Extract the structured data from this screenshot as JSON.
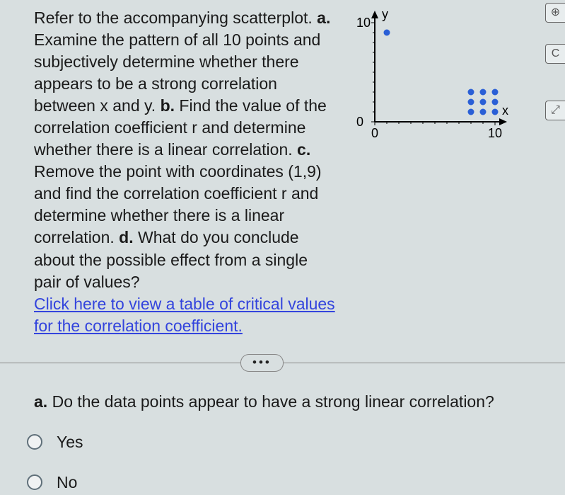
{
  "question": {
    "intro": "Refer to the accompanying scatterplot. ",
    "a_label": "a.",
    "a_text": " Examine the pattern of all 10 points and subjectively determine whether there appears to be a strong correlation between x and y. ",
    "b_label": "b.",
    "b_text": " Find the value of the correlation coefficient r and determine whether there is a linear correlation. ",
    "c_label": "c.",
    "c_text": " Remove the point with coordinates (1,9) and find the correlation coefficient r and determine whether there is a linear correlation. ",
    "d_label": "d.",
    "d_text": " What do you conclude about the possible effect from a single pair of values?",
    "link": "Click here to view a table of critical values for the correlation coefficient."
  },
  "chart_data": {
    "type": "scatter",
    "title": "",
    "xlabel": "x",
    "ylabel": "y",
    "xlim": [
      0,
      10
    ],
    "ylim": [
      0,
      10
    ],
    "xticks": [
      0,
      10
    ],
    "yticks": [
      0,
      10
    ],
    "points": [
      {
        "x": 1,
        "y": 9
      },
      {
        "x": 8,
        "y": 1
      },
      {
        "x": 8,
        "y": 2
      },
      {
        "x": 8,
        "y": 3
      },
      {
        "x": 9,
        "y": 1
      },
      {
        "x": 9,
        "y": 2
      },
      {
        "x": 9,
        "y": 3
      },
      {
        "x": 10,
        "y": 1
      },
      {
        "x": 10,
        "y": 2
      },
      {
        "x": 10,
        "y": 3
      }
    ]
  },
  "icons": {
    "plus": "⊕",
    "help": "C",
    "expand": "⤢"
  },
  "ellipsis": "•••",
  "subquestion": {
    "label": "a.",
    "text": " Do the data points appear to have a strong linear correlation?"
  },
  "options": {
    "yes": "Yes",
    "no": "No"
  }
}
